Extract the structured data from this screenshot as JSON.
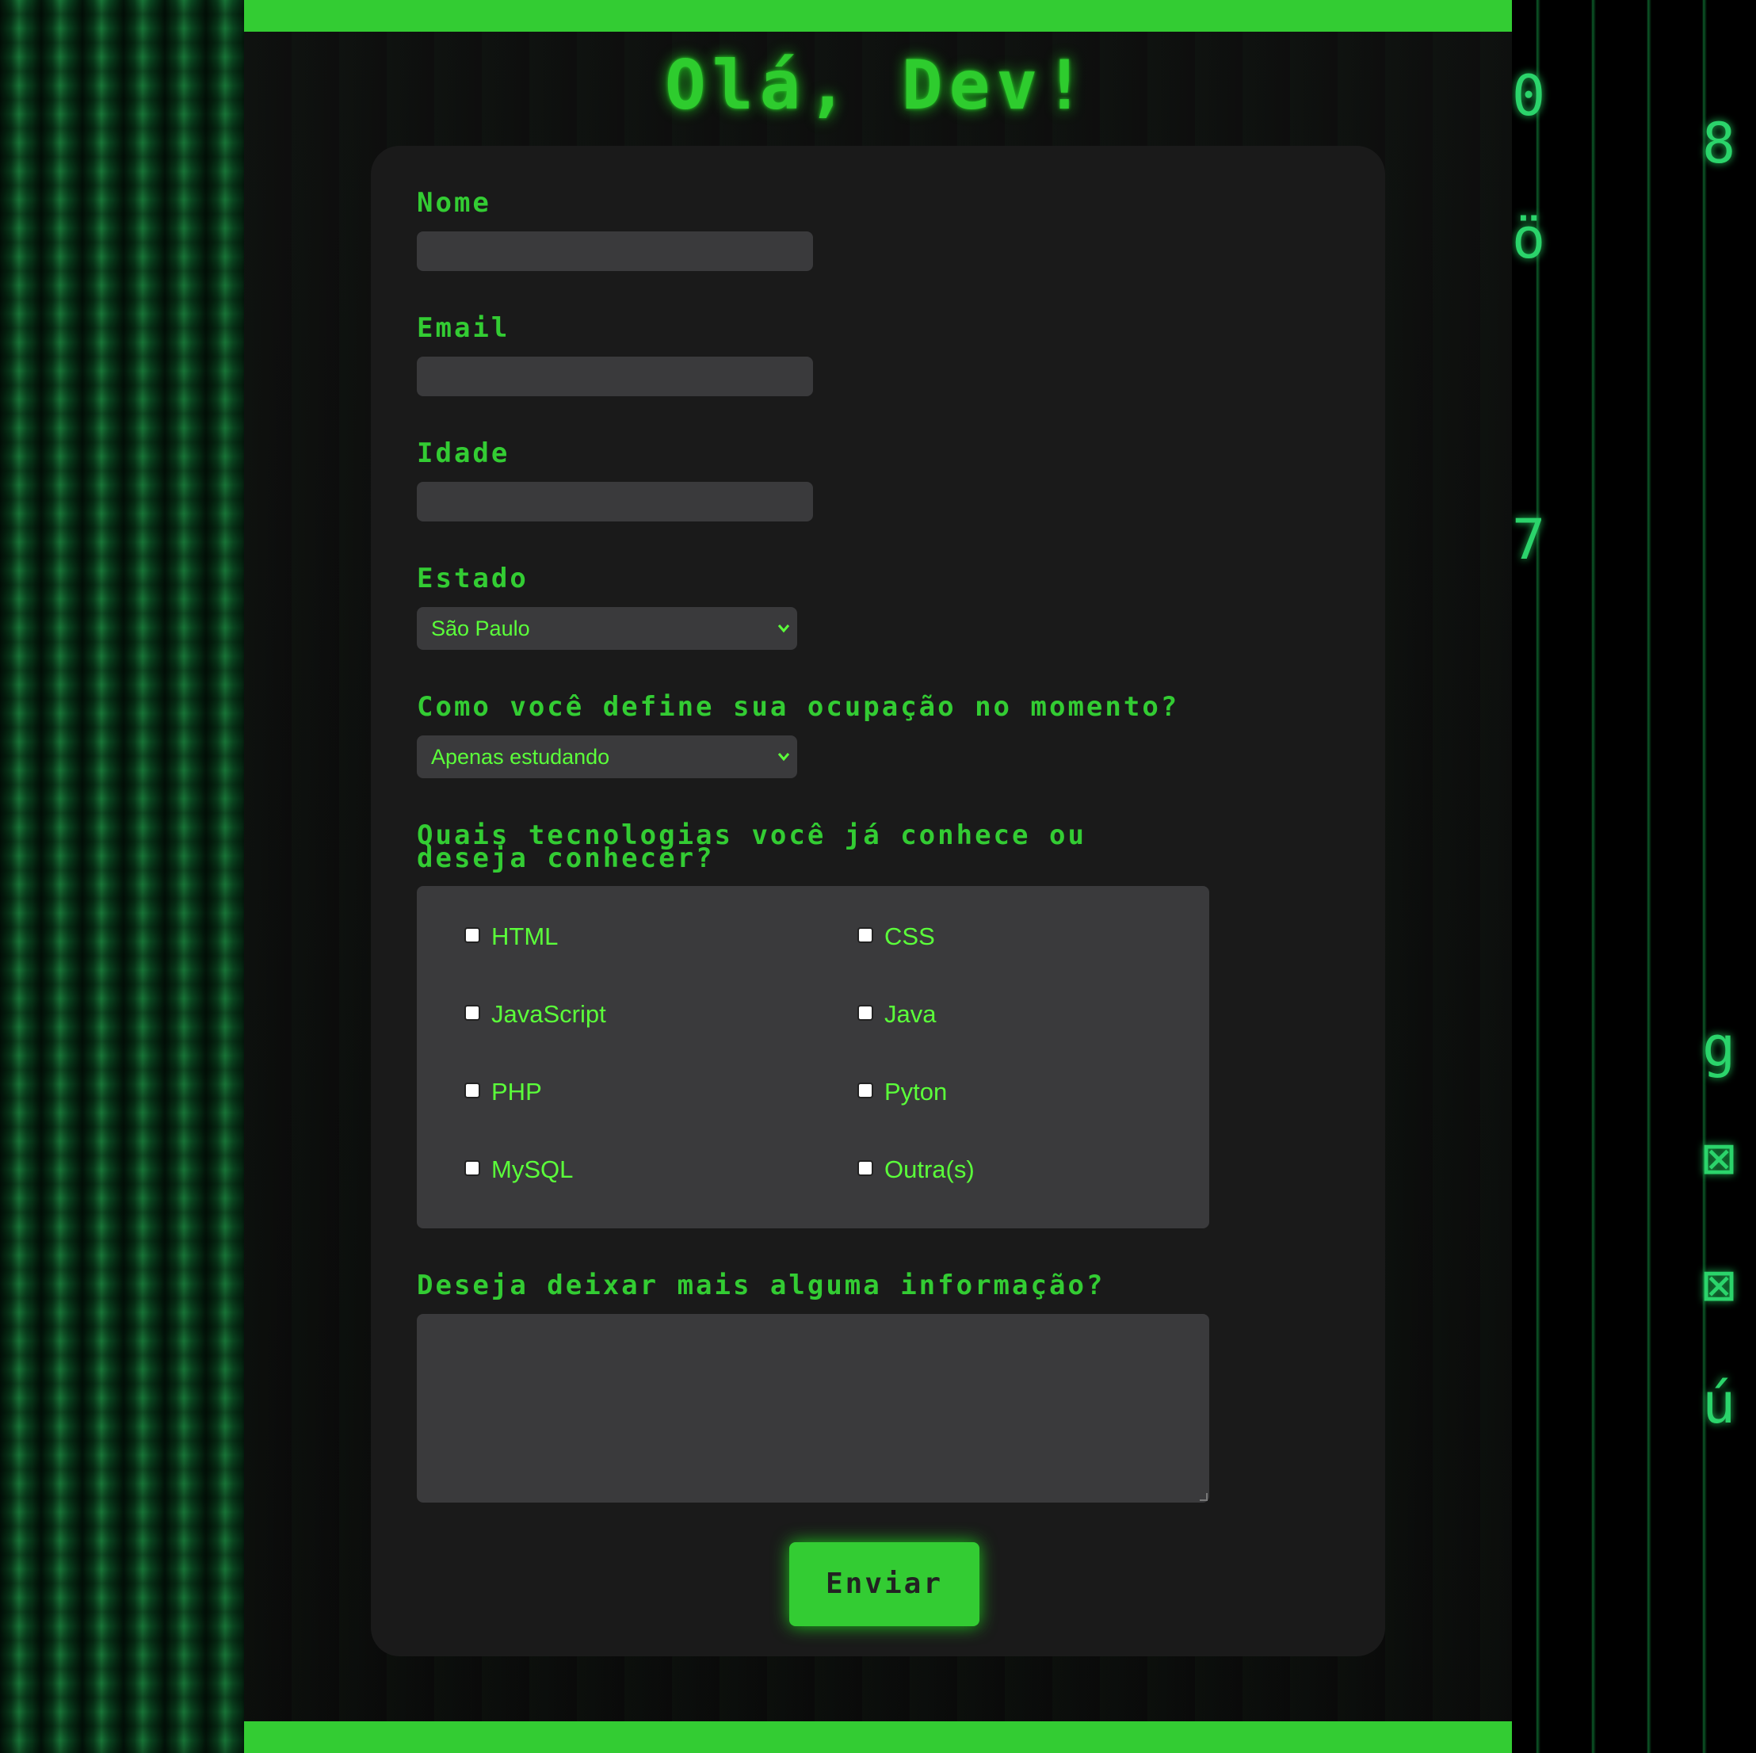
{
  "header": {
    "title": "Olá, Dev!"
  },
  "form": {
    "nome_label": "Nome",
    "email_label": "Email",
    "idade_label": "Idade",
    "estado_label": "Estado",
    "estado_value": "São Paulo",
    "ocupacao_label": "Como você define sua ocupação no momento?",
    "ocupacao_value": "Apenas estudando",
    "tecnologias_label_line1": "Quais tecnologias você já conhece ou",
    "tecnologias_label_line2": "deseja conhecer?",
    "tecnologias": [
      {
        "label": "HTML",
        "checked": false
      },
      {
        "label": "CSS",
        "checked": false
      },
      {
        "label": "JavaScript",
        "checked": false
      },
      {
        "label": "Java",
        "checked": false
      },
      {
        "label": "PHP",
        "checked": false
      },
      {
        "label": "Pyton",
        "checked": false
      },
      {
        "label": "MySQL",
        "checked": false
      },
      {
        "label": "Outra(s)",
        "checked": false
      }
    ],
    "info_label": "Deseja deixar mais alguma informação?",
    "submit_label": "Enviar"
  },
  "icons": {
    "select_chevron": "chevron-down-icon"
  },
  "colors": {
    "accent": "#33cc33",
    "text_accent": "#5bff3a",
    "card_bg": "#1a1a1a",
    "field_bg": "#3a3a3c"
  }
}
